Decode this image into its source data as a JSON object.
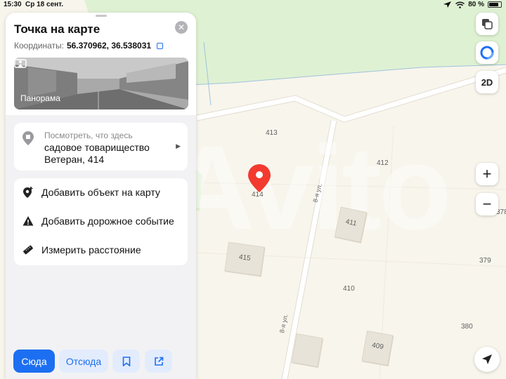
{
  "status_bar": {
    "time": "15:30",
    "date": "Ср 18 сент.",
    "battery": "80 %",
    "battery_level": 0.8
  },
  "panel": {
    "title": "Точка на карте",
    "coords_label": "Координаты:",
    "coords_value": "56.370962, 36.538031",
    "panorama_label": "Панорама",
    "what_here": {
      "hint": "Посмотреть, что здесь",
      "address": "садовое товарищество Ветеран, 414"
    },
    "actions": [
      {
        "label": "Добавить объект на карту",
        "icon": "add-place-icon"
      },
      {
        "label": "Добавить дорожное событие",
        "icon": "warning-icon"
      },
      {
        "label": "Измерить расстояние",
        "icon": "ruler-icon"
      }
    ],
    "buttons": {
      "here": "Сюда",
      "from": "Отсюда"
    }
  },
  "map": {
    "controls": {
      "mode": "2D",
      "zoom_in": "+",
      "zoom_out": "−"
    },
    "watermark": "Avito",
    "pin_label": "414",
    "labels": {
      "n413": "413",
      "n412": "412",
      "n410": "410",
      "n379": "379",
      "n380": "380",
      "n378": "378",
      "street_1": "8-я ул.",
      "street_2": "8-я ул."
    },
    "buildings": {
      "b411": "411",
      "b415": "415",
      "b409": "409"
    },
    "colors": {
      "accent": "#1d6ff2",
      "pin": "#f33a2f",
      "park": "#dff1d3",
      "road": "#ffffff"
    }
  }
}
